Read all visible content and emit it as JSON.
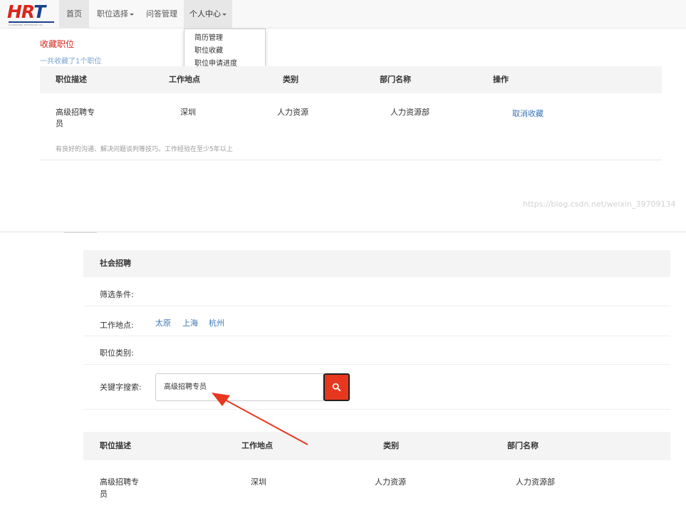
{
  "nav": {
    "logo_text": "HRT",
    "logo_sub": "GUANGDONG TECHNOLOGY CO.",
    "items": [
      {
        "label": "首页"
      },
      {
        "label": "职位选择"
      },
      {
        "label": "问答管理"
      },
      {
        "label": "个人中心"
      }
    ],
    "dropdown": [
      "简历管理",
      "职位收藏",
      "职位申请进度"
    ]
  },
  "favorites": {
    "title": "收藏职位",
    "count_text": "一共收藏了1个职位",
    "headers": [
      "职位描述",
      "工作地点",
      "类别",
      "部门名称",
      "操作"
    ],
    "row": {
      "name_line1": "高级招聘专",
      "name_line2": "员",
      "location": "深圳",
      "category": "人力资源",
      "department": "人力资源部",
      "action": "取消收藏",
      "description": "有良好的沟通、解决问题谈判等技巧。工作经验在至少5年以上"
    },
    "watermark": "https://blog.csdn.net/weixin_39709134"
  },
  "recruit": {
    "section_title": "社会招聘",
    "filter_label": "筛选条件:",
    "location_label": "工作地点:",
    "locations": [
      "太原",
      "上海",
      "杭州"
    ],
    "category_label": "职位类别:",
    "keyword_label": "关键字搜索:",
    "keyword_value": "高级招聘专员",
    "search_icon": "search-icon",
    "accent_color": "#e8371f",
    "headers": [
      "职位描述",
      "工作地点",
      "类别",
      "部门名称"
    ],
    "row": {
      "name_line1": "高级招聘专",
      "name_line2": "员",
      "location": "深圳",
      "category": "人力资源",
      "department": "人力资源部"
    }
  }
}
